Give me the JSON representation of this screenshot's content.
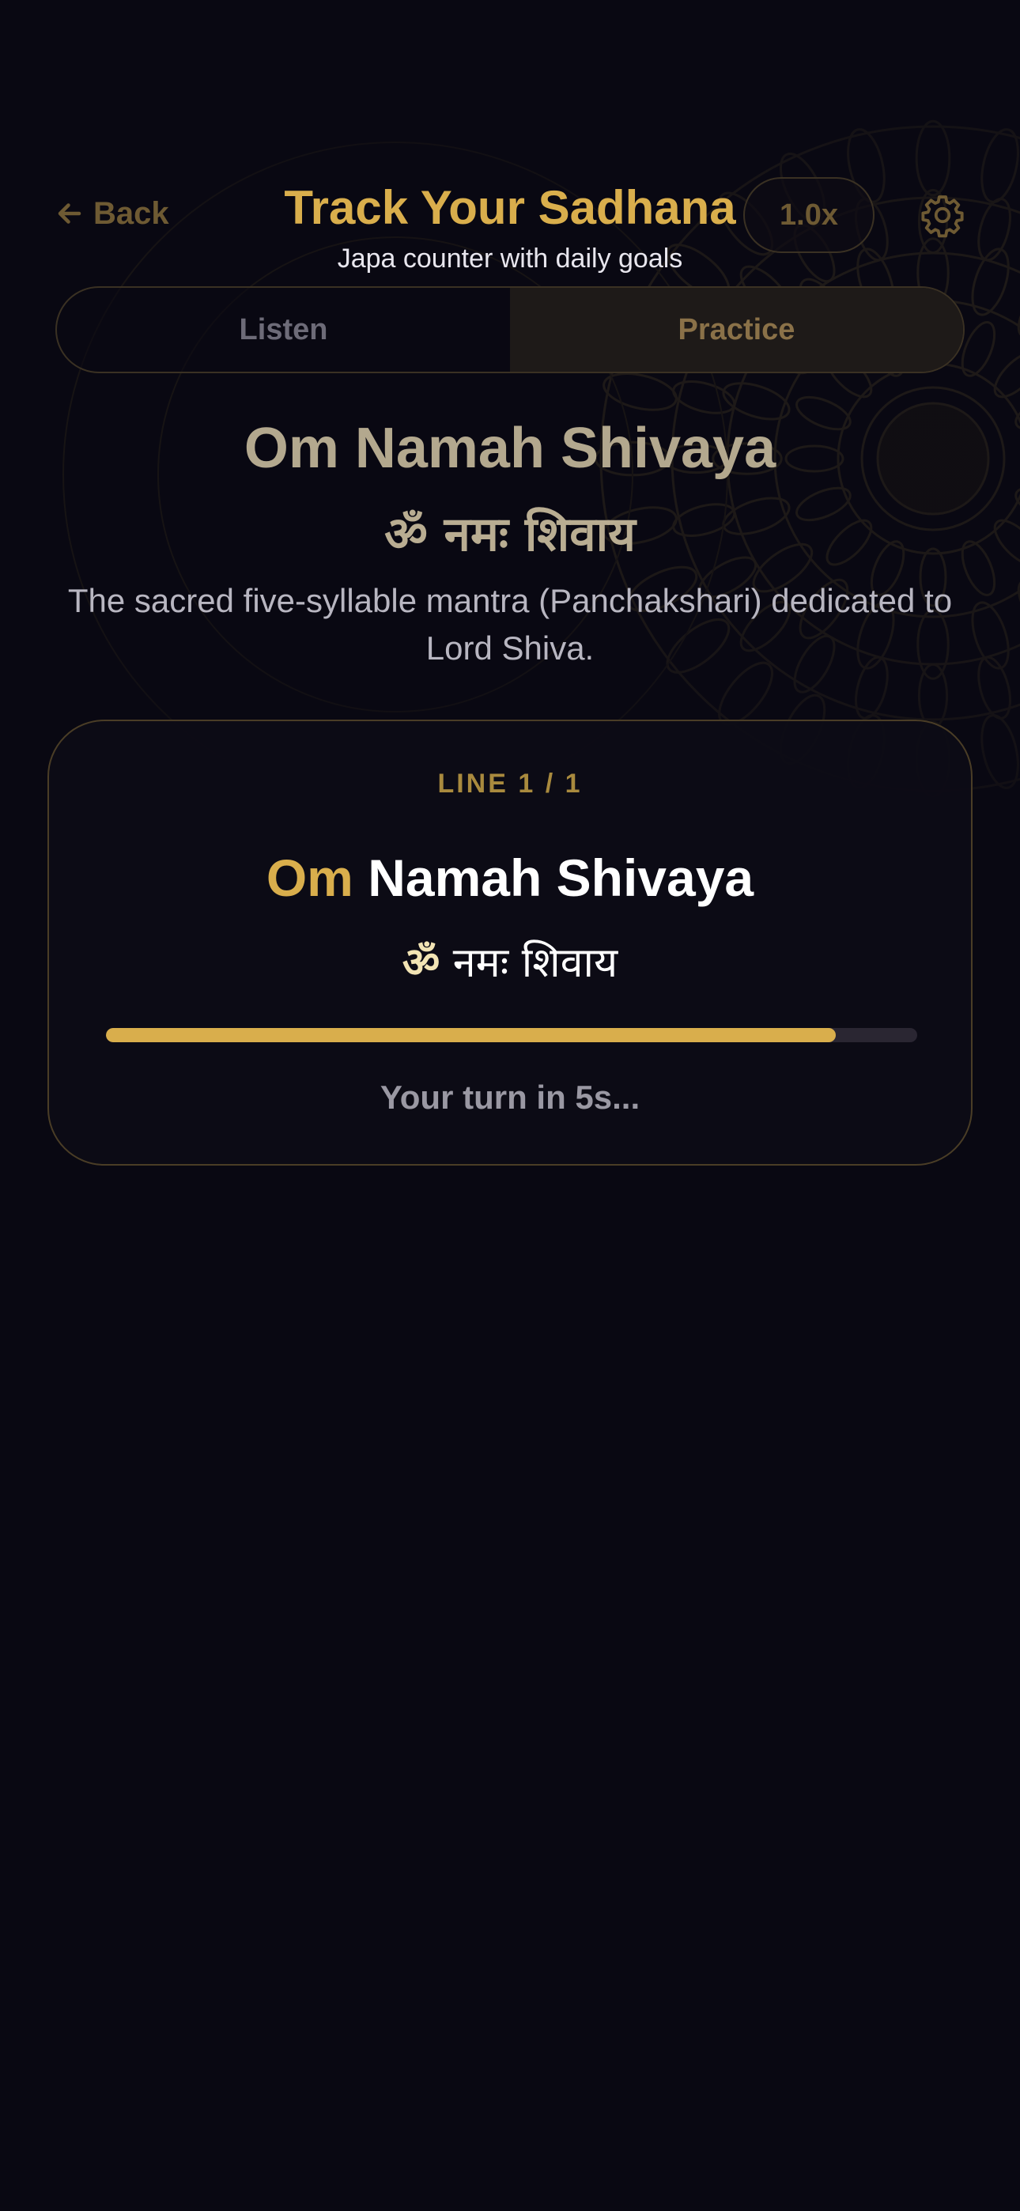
{
  "header": {
    "back_label": "Back",
    "title": "Track Your Sadhana",
    "subtitle": "Japa counter with daily goals",
    "speed_label": "1.0x"
  },
  "tabs": [
    {
      "label": "Listen",
      "active": false
    },
    {
      "label": "Practice",
      "active": true
    }
  ],
  "mantra": {
    "name": "Om Namah Shivaya",
    "devanagari": "ॐ नमः शिवाय",
    "description": "The sacred five-syllable mantra (Panchakshari) dedicated to Lord Shiva."
  },
  "practice": {
    "line_counter": "LINE 1 / 1",
    "line_highlight": "Om",
    "line_rest": "Namah Shivaya",
    "devanagari_highlight": "ॐ",
    "devanagari_rest": "नमः शिवाय",
    "progress_fraction": 0.9,
    "countdown": "Your turn in 5s..."
  },
  "colors": {
    "accent": "#d9ae4c",
    "background": "#090812",
    "muted_gold": "#6e5a33"
  },
  "icons": {
    "back": "arrow-left-icon",
    "settings": "gear-icon"
  }
}
